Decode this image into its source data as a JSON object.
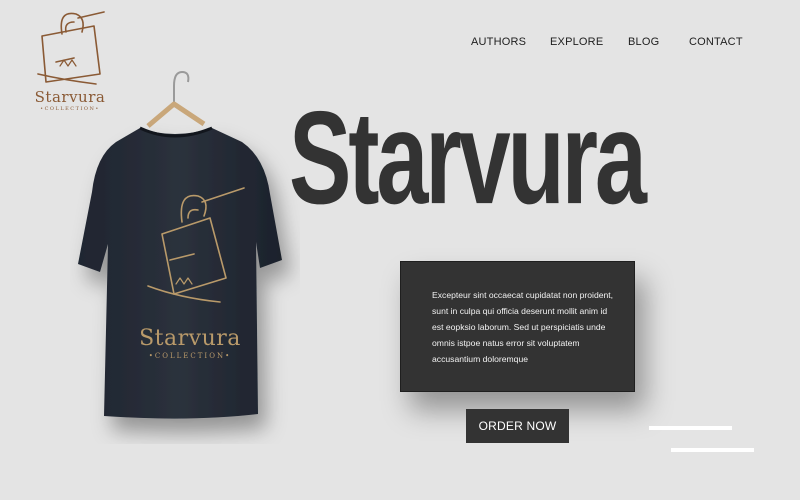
{
  "brand": {
    "name": "Starvura",
    "logo_word": "Starvura",
    "logo_sub": "•COLLECTION•",
    "shirt_word": "Starvura",
    "shirt_sub": "•COLLECTION•"
  },
  "nav": {
    "items": [
      {
        "label": "AUTHORS"
      },
      {
        "label": "EXPLORE"
      },
      {
        "label": "BLOG"
      },
      {
        "label": "CONTACT"
      }
    ]
  },
  "hero": {
    "title": "Starvura"
  },
  "info": {
    "text": "Excepteur sint occaecat cupidatat non proident, sunt in culpa qui officia deserunt mollit anim id est eopksio laborum. Sed ut perspiciatis unde omnis istpoe natus error sit voluptatem accusantium doloremque"
  },
  "cta": {
    "label": "ORDER NOW"
  },
  "colors": {
    "background": "#e4e4e4",
    "dark": "#333333",
    "gold": "#b99a6a",
    "brown": "#8a5a35"
  }
}
